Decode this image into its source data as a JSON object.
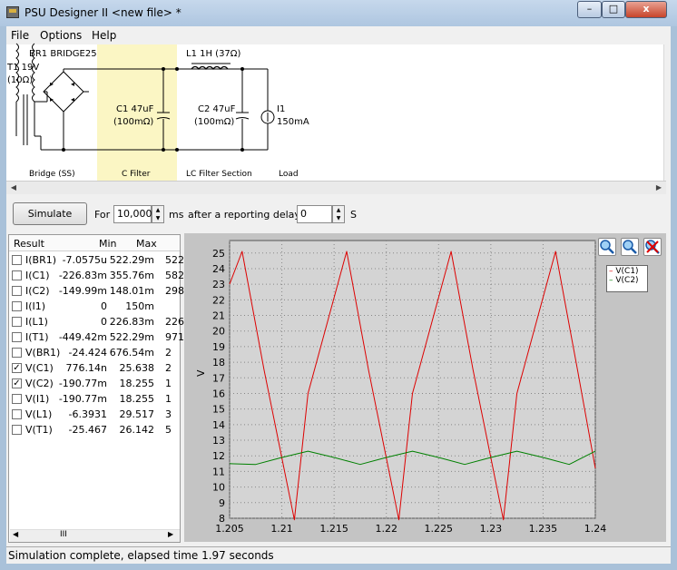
{
  "window": {
    "title": "PSU Designer II  <new file> *",
    "min_btn": "–",
    "max_btn": "□",
    "close_btn": "x"
  },
  "menu": [
    "File",
    "Options",
    "Help"
  ],
  "schematic": {
    "bridge": "BR1 BRIDGE25",
    "transformer": "T1 19V",
    "transformer_r": "(10Ω)",
    "c1": "C1 47uF",
    "c1_esr": "(100mΩ)",
    "l1": "L1 1H (37Ω)",
    "c2": "C2 47uF",
    "c2_esr": "(100mΩ)",
    "load": "I1",
    "load_val": "150mA",
    "sections": [
      "Bridge (SS)",
      "C Filter",
      "LC Filter Section",
      "Load"
    ]
  },
  "sim": {
    "button": "Simulate",
    "for_label": "For",
    "duration": "10,000",
    "unit1": "ms",
    "delay_label": "after a reporting delay of",
    "delay": "0",
    "unit2": "S"
  },
  "results": {
    "headers": [
      "Result",
      "Min",
      "Max"
    ],
    "rows": [
      {
        "name": "I(BR1)",
        "min": "-7.0575u",
        "max": "522.29m",
        "extra": "522",
        "checked": false
      },
      {
        "name": "I(C1)",
        "min": "-226.83m",
        "max": "355.76m",
        "extra": "582",
        "checked": false
      },
      {
        "name": "I(C2)",
        "min": "-149.99m",
        "max": "148.01m",
        "extra": "298",
        "checked": false
      },
      {
        "name": "I(I1)",
        "min": "0",
        "max": "150m",
        "extra": "",
        "checked": false
      },
      {
        "name": "I(L1)",
        "min": "0",
        "max": "226.83m",
        "extra": "226",
        "checked": false
      },
      {
        "name": "I(T1)",
        "min": "-449.42m",
        "max": "522.29m",
        "extra": "971",
        "checked": false
      },
      {
        "name": "V(BR1)",
        "min": "-24.424",
        "max": "676.54m",
        "extra": "2",
        "checked": false
      },
      {
        "name": "V(C1)",
        "min": "776.14n",
        "max": "25.638",
        "extra": "2",
        "checked": true
      },
      {
        "name": "V(C2)",
        "min": "-190.77m",
        "max": "18.255",
        "extra": "1",
        "checked": true
      },
      {
        "name": "V(I1)",
        "min": "-190.77m",
        "max": "18.255",
        "extra": "1",
        "checked": false
      },
      {
        "name": "V(L1)",
        "min": "-6.3931",
        "max": "29.517",
        "extra": "3",
        "checked": false
      },
      {
        "name": "V(T1)",
        "min": "-25.467",
        "max": "26.142",
        "extra": "5",
        "checked": false
      }
    ],
    "scroll_label": "III"
  },
  "colors": {
    "vc1": "#dd0000",
    "vc2": "#008000",
    "plot_bg": "#d4d4d4"
  },
  "chart_data": {
    "type": "line",
    "xlabel": "",
    "ylabel": "V",
    "xlim": [
      1.205,
      1.24
    ],
    "ylim": [
      8,
      25.8
    ],
    "xticks": [
      "1.205",
      "1.21",
      "1.215",
      "1.22",
      "1.225",
      "1.23",
      "1.235",
      "1.24"
    ],
    "yticks": [
      "8",
      "9",
      "10",
      "11",
      "12",
      "13",
      "14",
      "15",
      "16",
      "17",
      "18",
      "19",
      "20",
      "21",
      "22",
      "23",
      "24",
      "25"
    ],
    "grid": true,
    "legend_position": "top-right",
    "series": [
      {
        "name": "V(C1)",
        "x": [
          1.205,
          1.2062,
          1.2083,
          1.2112,
          1.2125,
          1.2162,
          1.2183,
          1.2212,
          1.2225,
          1.2262,
          1.2283,
          1.2312,
          1.2325,
          1.2362,
          1.2383,
          1.24
        ],
        "values": [
          23.0,
          25.1,
          17.5,
          7.9,
          16.0,
          25.1,
          17.5,
          7.9,
          16.0,
          25.1,
          17.5,
          7.9,
          16.0,
          25.1,
          17.5,
          11.2
        ]
      },
      {
        "name": "V(C2)",
        "x": [
          1.205,
          1.2075,
          1.21,
          1.2125,
          1.215,
          1.2175,
          1.22,
          1.2225,
          1.225,
          1.2275,
          1.23,
          1.2325,
          1.235,
          1.2375,
          1.24
        ],
        "values": [
          11.5,
          11.45,
          11.9,
          12.3,
          11.9,
          11.45,
          11.9,
          12.3,
          11.9,
          11.45,
          11.9,
          12.3,
          11.9,
          11.45,
          12.3
        ]
      }
    ]
  },
  "status": "Simulation complete, elapsed time 1.97 seconds"
}
